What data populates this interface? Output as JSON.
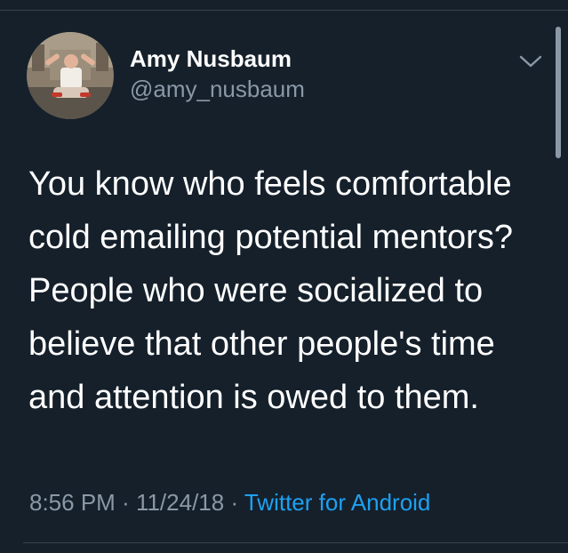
{
  "tweet": {
    "author": {
      "name": "Amy Nusbaum",
      "handle": "@amy_nusbaum",
      "avatar_icon": "profile-photo"
    },
    "menu_icon": "chevron-down-icon",
    "text_lines": [
      "You know who feels comfortable",
      "cold emailing potential mentors?",
      "People who were socialized to",
      "believe that other people's time",
      "and attention is owed to them."
    ],
    "time": "8:56 PM",
    "separator": " · ",
    "date": "11/24/18",
    "source": "Twitter for Android"
  },
  "colors": {
    "background": "#15202b",
    "text": "#ffffff",
    "secondary": "#8b98a5",
    "link": "#1da1f2",
    "divider": "#38444d"
  }
}
